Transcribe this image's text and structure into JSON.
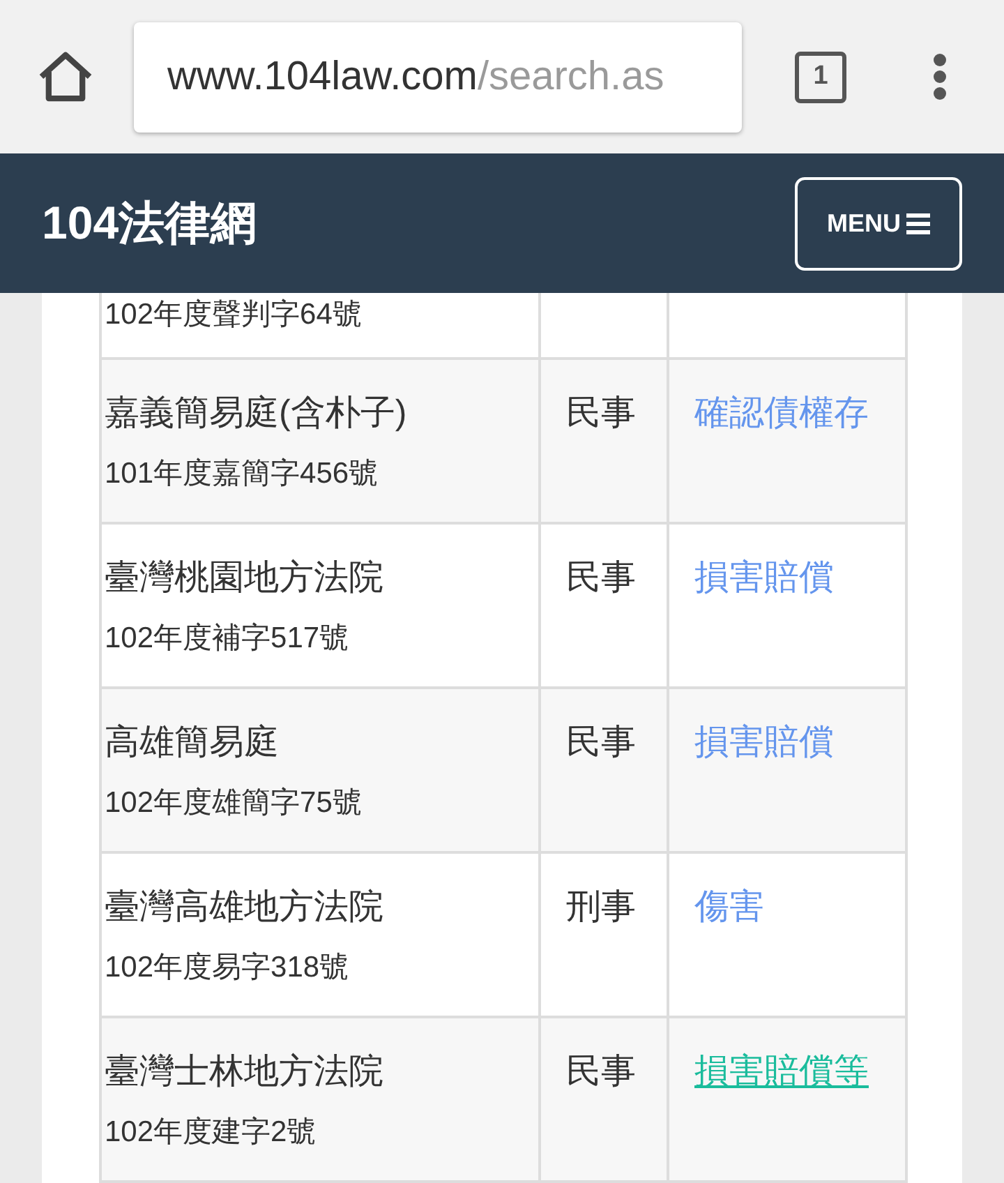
{
  "browser": {
    "url_host": "www.104law.com",
    "url_path": "/search.as",
    "tab_count": "1"
  },
  "header": {
    "title": "104法律網",
    "menu_label": "MENU"
  },
  "table": {
    "rows": [
      {
        "case_number": "102年度聲判字64號"
      },
      {
        "court": "嘉義簡易庭(含朴子)",
        "case_number": "101年度嘉簡字456號",
        "case_type": "民事",
        "cause": {
          "text": "確認債權存",
          "highlighted": false
        }
      },
      {
        "court": "臺灣桃園地方法院",
        "case_number": "102年度補字517號",
        "case_type": "民事",
        "cause": {
          "text": "損害賠償",
          "highlighted": false
        }
      },
      {
        "court": "高雄簡易庭",
        "case_number": "102年度雄簡字75號",
        "case_type": "民事",
        "cause": {
          "text": "損害賠償",
          "highlighted": false
        }
      },
      {
        "court": "臺灣高雄地方法院",
        "case_number": "102年度易字318號",
        "case_type": "刑事",
        "cause": {
          "text": "傷害",
          "highlighted": false
        }
      },
      {
        "court": "臺灣士林地方法院",
        "case_number": "102年度建字2號",
        "case_type": "民事",
        "cause": {
          "text": "損害賠償等",
          "highlighted": true
        }
      }
    ]
  }
}
